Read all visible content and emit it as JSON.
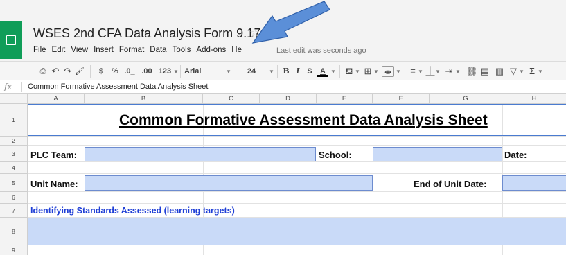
{
  "app": {
    "doc_title": "WSES 2nd CFA Data Analysis Form 9.17.15",
    "last_edit": "Last edit was seconds ago",
    "logo_icon": "sheets-logo-icon",
    "brand_color": "#0f9d58"
  },
  "menu": [
    "File",
    "Edit",
    "View",
    "Insert",
    "Format",
    "Data",
    "Tools",
    "Add-ons",
    "He"
  ],
  "toolbar": {
    "currency": "$",
    "percent": "%",
    "decimal_decrease": ".0_",
    "decimal_increase": ".00",
    "more_formats": "123",
    "font": "Arial",
    "font_size": "24",
    "bold": "B",
    "italic": "I",
    "strikethrough": "S",
    "text_color": "A"
  },
  "formula_bar": {
    "fx": "fx",
    "value": "Common Formative Assessment Data Analysis Sheet"
  },
  "columns": [
    "A",
    "B",
    "C",
    "D",
    "E",
    "F",
    "G",
    "H"
  ],
  "rows": [
    "1",
    "2",
    "3",
    "4",
    "5",
    "6",
    "7",
    "8",
    "9"
  ],
  "sheet": {
    "title": "Common Formative Assessment Data Analysis Sheet",
    "plc_team_label": "PLC Team:",
    "school_label": "School:",
    "date_label": "Date:",
    "unit_name_label": "Unit Name:",
    "end_of_unit_date_label": "End of Unit Date:",
    "standards_heading": "Identifying Standards Assessed  (learning targets)",
    "input_fill_color": "#c9daf8",
    "heading_color": "#1f3fd6"
  },
  "annotation": {
    "arrow_color": "#5b8fd8"
  }
}
